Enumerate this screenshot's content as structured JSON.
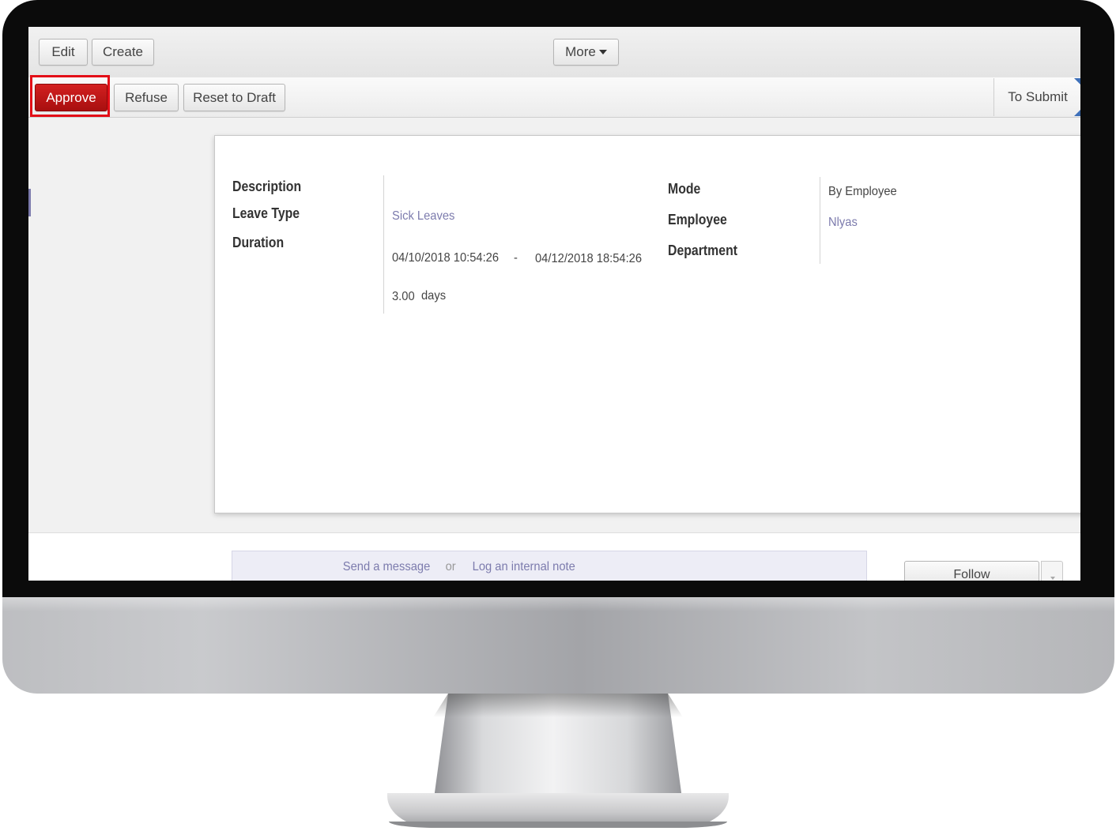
{
  "toolbar": {
    "edit_label": "Edit",
    "create_label": "Create",
    "more_label": "More"
  },
  "statusbar": {
    "approve_label": "Approve",
    "refuse_label": "Refuse",
    "reset_label": "Reset to Draft",
    "stage_label": "To Submit"
  },
  "form": {
    "description_label": "Description",
    "leave_type_label": "Leave Type",
    "leave_type_value": "Sick Leaves",
    "duration_label": "Duration",
    "date_from": "04/10/2018 10:54:26",
    "date_separator": "-",
    "date_to": "04/12/2018 18:54:26",
    "duration_days": "3.00",
    "duration_unit": "days",
    "mode_label": "Mode",
    "mode_value": "By Employee",
    "employee_label": "Employee",
    "employee_value": "Nlyas",
    "department_label": "Department"
  },
  "chatter": {
    "send_message": "Send a message",
    "or": "or",
    "log_note": "Log an internal note",
    "follow_label": "Follow"
  },
  "colors": {
    "approve": "#c21a1a",
    "highlight": "#e30e17",
    "link": "#7c7bad"
  }
}
